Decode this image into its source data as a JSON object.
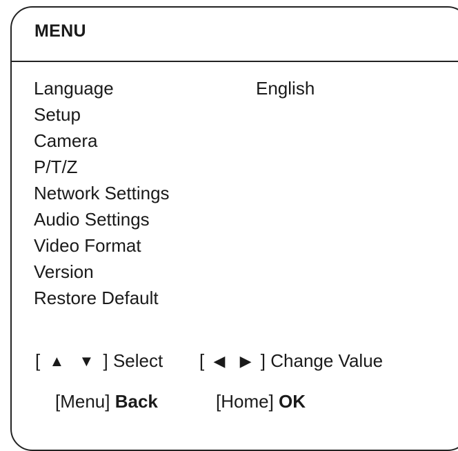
{
  "menu": {
    "title": "MENU",
    "items": [
      {
        "label": "Language",
        "value": "English"
      },
      {
        "label": "Setup"
      },
      {
        "label": "Camera"
      },
      {
        "label": "P/T/Z"
      },
      {
        "label": "Network Settings"
      },
      {
        "label": "Audio Settings"
      },
      {
        "label": "Video Format"
      },
      {
        "label": "Version"
      },
      {
        "label": "Restore Default"
      }
    ]
  },
  "hints": {
    "select": {
      "open": "[",
      "up_glyph": "▲",
      "down_glyph": "▼",
      "close": "]",
      "label": "Select",
      "icons": [
        "up-arrow-icon",
        "down-arrow-icon"
      ]
    },
    "change_value": {
      "open": "[",
      "left_glyph": "◀",
      "right_glyph": "▶",
      "close": "]",
      "label": "Change Value",
      "icons": [
        "left-arrow-icon",
        "right-arrow-icon"
      ]
    }
  },
  "actions": {
    "back": {
      "key": "[Menu]",
      "label": "Back"
    },
    "ok": {
      "key": "[Home]",
      "label": "OK"
    }
  },
  "colors": {
    "text": "#1a1a1a",
    "frame": "#222222",
    "background": "#ffffff"
  }
}
